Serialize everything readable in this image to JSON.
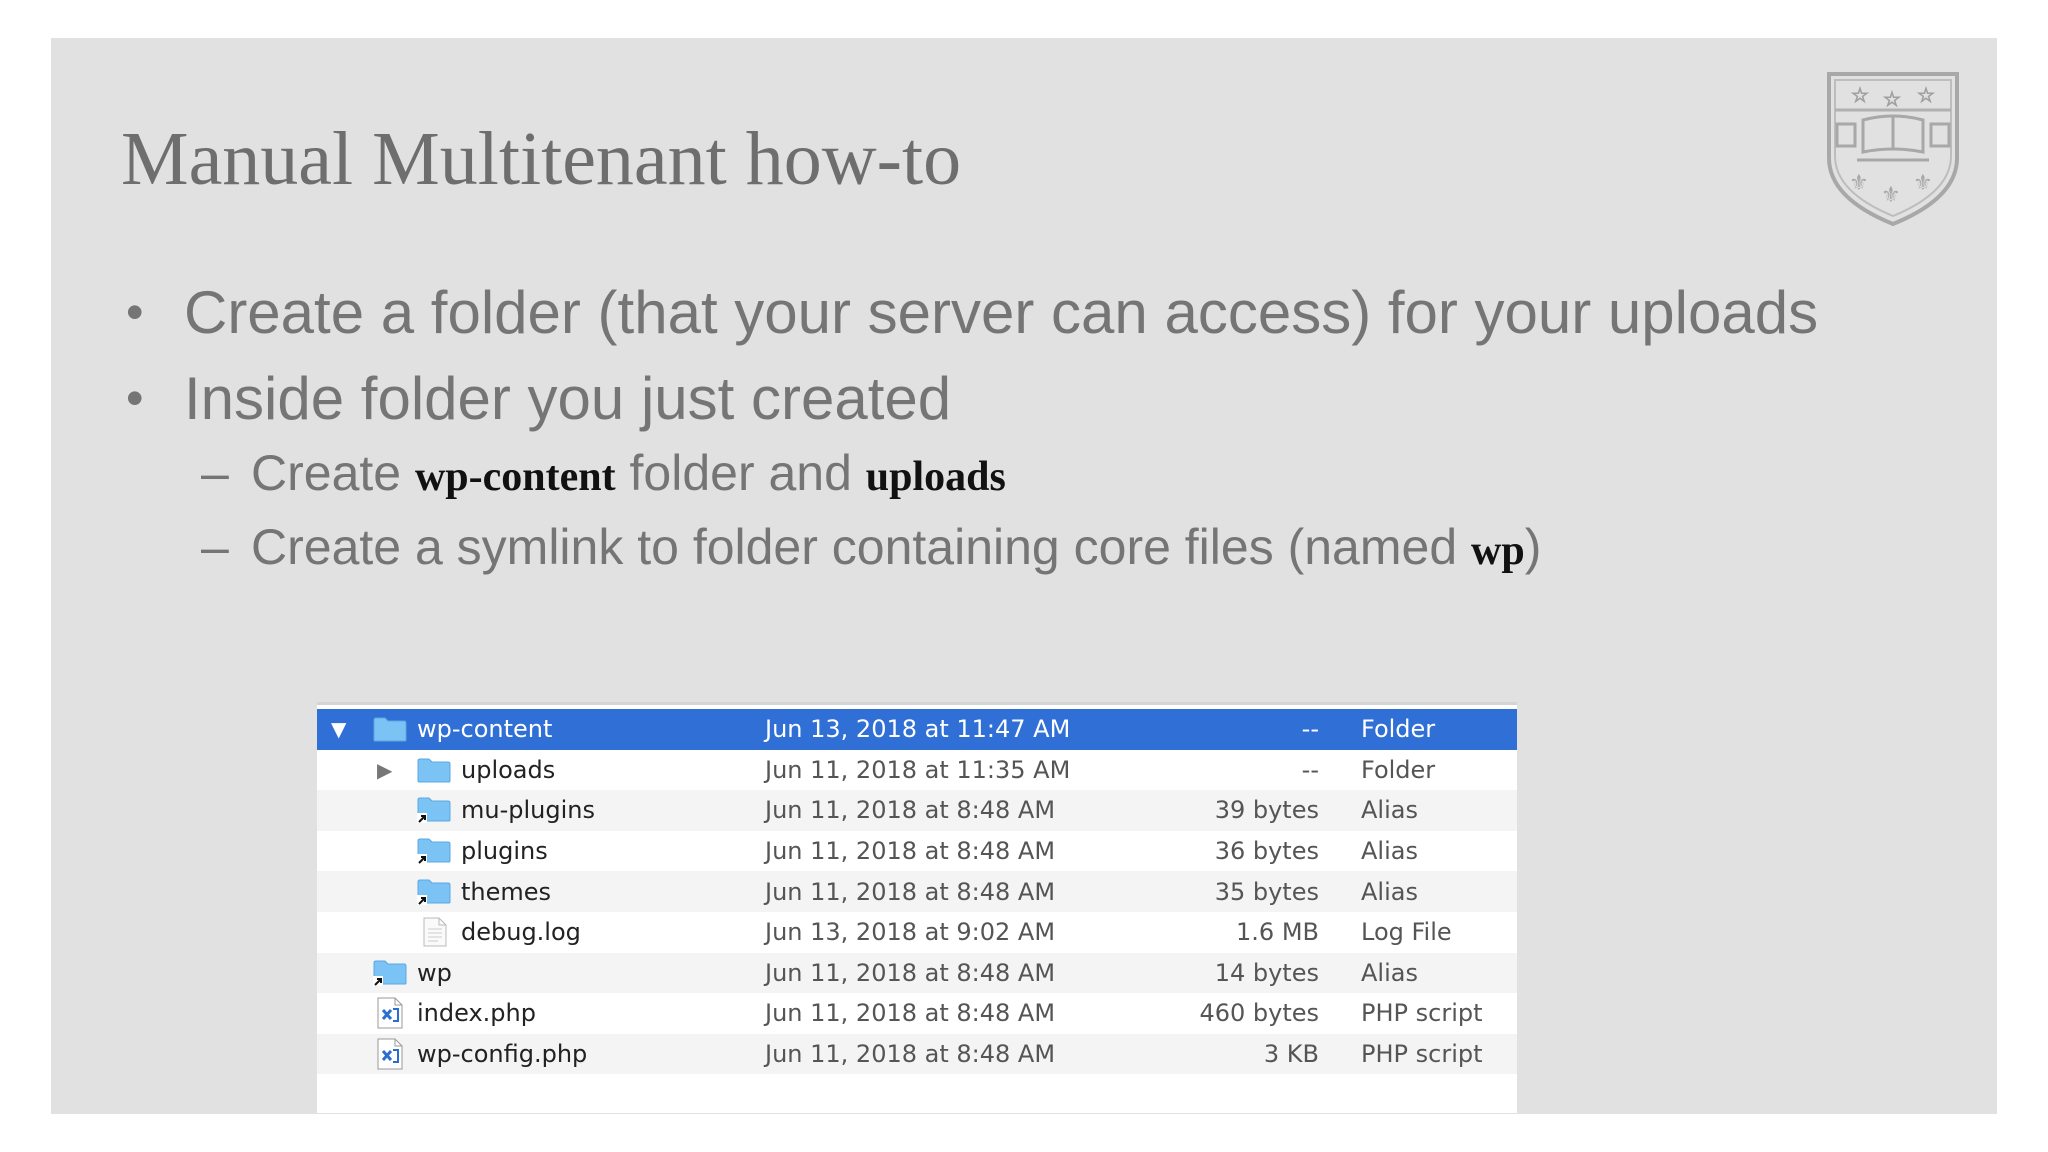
{
  "slide": {
    "title": "Manual Multitenant how-to",
    "bullets": [
      {
        "text": "Create a folder (that your server can access) for your uploads"
      },
      {
        "text": "Inside folder you just created"
      }
    ],
    "sub_bullets": [
      {
        "pre": "Create ",
        "code1": "wp-content",
        "mid": " folder and ",
        "code2": "uploads"
      },
      {
        "pre": "Create a symlink to folder containing core files (named ",
        "code1": "wp",
        "post": ")"
      }
    ],
    "bullet_glyph": "•",
    "dash_glyph": "–"
  },
  "finder": {
    "rows": [
      {
        "name": "wp-content",
        "date": "Jun 13, 2018 at 11:47 AM",
        "size": "--",
        "kind": "Folder",
        "icon": "folder-icon",
        "disclosure": "▼",
        "selected": true
      },
      {
        "name": "uploads",
        "date": "Jun 11, 2018 at 11:35 AM",
        "size": "--",
        "kind": "Folder",
        "icon": "folder-icon",
        "disclosure": "▶"
      },
      {
        "name": "mu-plugins",
        "date": "Jun 11, 2018 at 8:48 AM",
        "size": "39 bytes",
        "kind": "Alias",
        "icon": "folder-alias-icon"
      },
      {
        "name": "plugins",
        "date": "Jun 11, 2018 at 8:48 AM",
        "size": "36 bytes",
        "kind": "Alias",
        "icon": "folder-alias-icon"
      },
      {
        "name": "themes",
        "date": "Jun 11, 2018 at 8:48 AM",
        "size": "35 bytes",
        "kind": "Alias",
        "icon": "folder-alias-icon"
      },
      {
        "name": "debug.log",
        "date": "Jun 13, 2018 at 9:02 AM",
        "size": "1.6 MB",
        "kind": "Log File",
        "icon": "log-file-icon"
      },
      {
        "name": "wp",
        "date": "Jun 11, 2018 at 8:48 AM",
        "size": "14 bytes",
        "kind": "Alias",
        "icon": "folder-alias-icon"
      },
      {
        "name": "index.php",
        "date": "Jun 11, 2018 at 8:48 AM",
        "size": "460 bytes",
        "kind": "PHP script",
        "icon": "php-file-icon"
      },
      {
        "name": "wp-config.php",
        "date": "Jun 11, 2018 at 8:48 AM",
        "size": "3 KB",
        "kind": "PHP script",
        "icon": "php-file-icon"
      }
    ]
  }
}
